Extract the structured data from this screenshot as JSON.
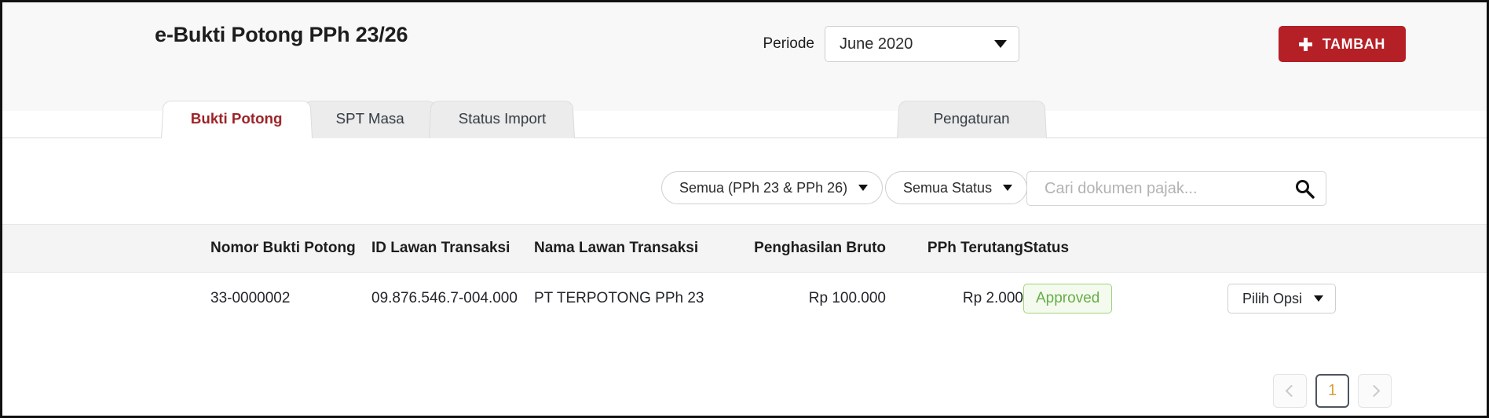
{
  "header": {
    "title": "e-Bukti Potong PPh 23/26",
    "period_label": "Periode",
    "period_value": "June  2020",
    "add_button": "TAMBAH",
    "add_icon": "plus-icon",
    "dropdown_icon": "chevron-down-icon"
  },
  "tabs": [
    {
      "label": "Bukti Potong",
      "active": true
    },
    {
      "label": "SPT Masa",
      "active": false
    },
    {
      "label": "Status Import",
      "active": false
    },
    {
      "label": "Pengaturan",
      "active": false
    }
  ],
  "filters": {
    "jenis": "Semua (PPh 23 & PPh 26)",
    "status": "Semua Status",
    "search_value": "",
    "search_placeholder": "Cari dokumen pajak...",
    "search_icon": "search-icon"
  },
  "table": {
    "columns": [
      "Nomor Bukti Potong",
      "ID Lawan Transaksi",
      "Nama Lawan Transaksi",
      "Penghasilan Bruto",
      "PPh Terutang",
      "Status"
    ],
    "rows": [
      {
        "nomor": "33-0000002",
        "id_lawan": "09.876.546.7-004.000",
        "nama_lawan": "PT TERPOTONG PPh 23",
        "bruto": "Rp 100.000",
        "pph": "Rp 2.000",
        "status": "Approved",
        "action": "Pilih Opsi"
      }
    ]
  },
  "pagination": {
    "prev_icon": "chevron-left-icon",
    "next_icon": "chevron-right-icon",
    "current": "1"
  },
  "colors": {
    "brand_red": "#b51f26",
    "active_tab_text": "#9b2226",
    "status_green": "#67ad4a",
    "page_current": "#d8a13a"
  }
}
